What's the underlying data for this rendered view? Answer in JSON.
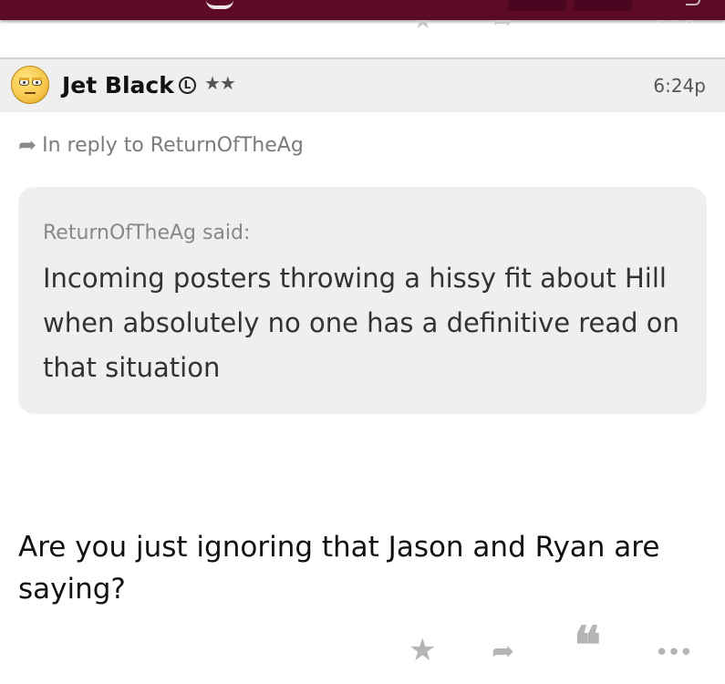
{
  "post": {
    "username": "Jet Black",
    "badge": "L",
    "stars": "★★",
    "time": "6:24p",
    "reply_to": "In reply to ReturnOfTheAg",
    "quote": {
      "author": "ReturnOfTheAg said:",
      "text": "Incoming posters throwing a hissy fit about Hill when absolutely no one has a definitive read on that situation"
    },
    "body": "Are you just ignoring that Jason and Ryan are saying?"
  },
  "icons": {
    "reply": "reply-arrow-icon",
    "star": "star-icon",
    "quote": "quote-icon",
    "more": "more-icon"
  },
  "glyphs": {
    "reply": "➦",
    "star": "★",
    "quote": "❝",
    "more": "•••"
  },
  "colors": {
    "brand": "#5c0a26",
    "header_bg": "#efefef",
    "quote_bg": "#efefef",
    "action_gray": "#b5b5b5"
  }
}
